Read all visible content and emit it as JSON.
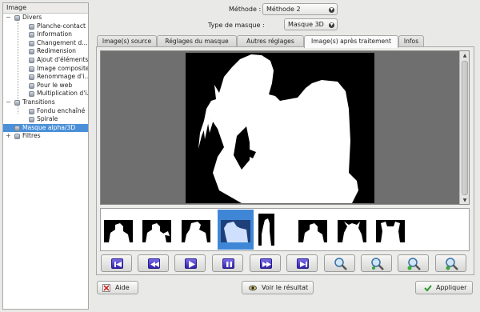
{
  "tree": {
    "header": "Image",
    "items": [
      {
        "label": "Divers",
        "level": 0,
        "expander": "−"
      },
      {
        "label": "Planche-contact",
        "level": 1
      },
      {
        "label": "Information",
        "level": 1
      },
      {
        "label": "Changement d...",
        "level": 1
      },
      {
        "label": "Redimension",
        "level": 1
      },
      {
        "label": "Ajout d'éléments",
        "level": 1
      },
      {
        "label": "Image composite",
        "level": 1
      },
      {
        "label": "Renommage d'i...",
        "level": 1
      },
      {
        "label": "Pour le web",
        "level": 1
      },
      {
        "label": "Multiplication d'i...",
        "level": 1
      },
      {
        "label": "Transitions",
        "level": 0,
        "expander": "−"
      },
      {
        "label": "Fondu enchaîné",
        "level": 1
      },
      {
        "label": "Spirale",
        "level": 1
      },
      {
        "label": "Masque alpha/3D",
        "level": 0,
        "selected": true
      },
      {
        "label": "Filtres",
        "level": 0,
        "expander": "+"
      }
    ]
  },
  "method": {
    "label": "Méthode :",
    "value": "Méthode 2"
  },
  "mask_type": {
    "label": "Type de masque :",
    "value": "Masque 3D"
  },
  "tabs": [
    {
      "label": "Image(s) source"
    },
    {
      "label": "Réglages du masque"
    },
    {
      "label": "Autres réglages"
    },
    {
      "label": "Image(s) après traitement",
      "active": true
    },
    {
      "label": "Infos"
    }
  ],
  "controls": [
    "first-frame-icon",
    "rewind-icon",
    "play-icon",
    "pause-icon",
    "fast-forward-icon",
    "last-frame-icon",
    "zoom-icon",
    "zoom-in-icon",
    "zoom-out-icon",
    "zoom-fit-icon"
  ],
  "bottom": {
    "help": "Aide",
    "preview": "Voir le résultat",
    "apply": "Appliquer"
  },
  "colors": {
    "selection": "#4a90d9",
    "thumb_selected": "#3f87d6",
    "transport": "#4a3ad0"
  }
}
